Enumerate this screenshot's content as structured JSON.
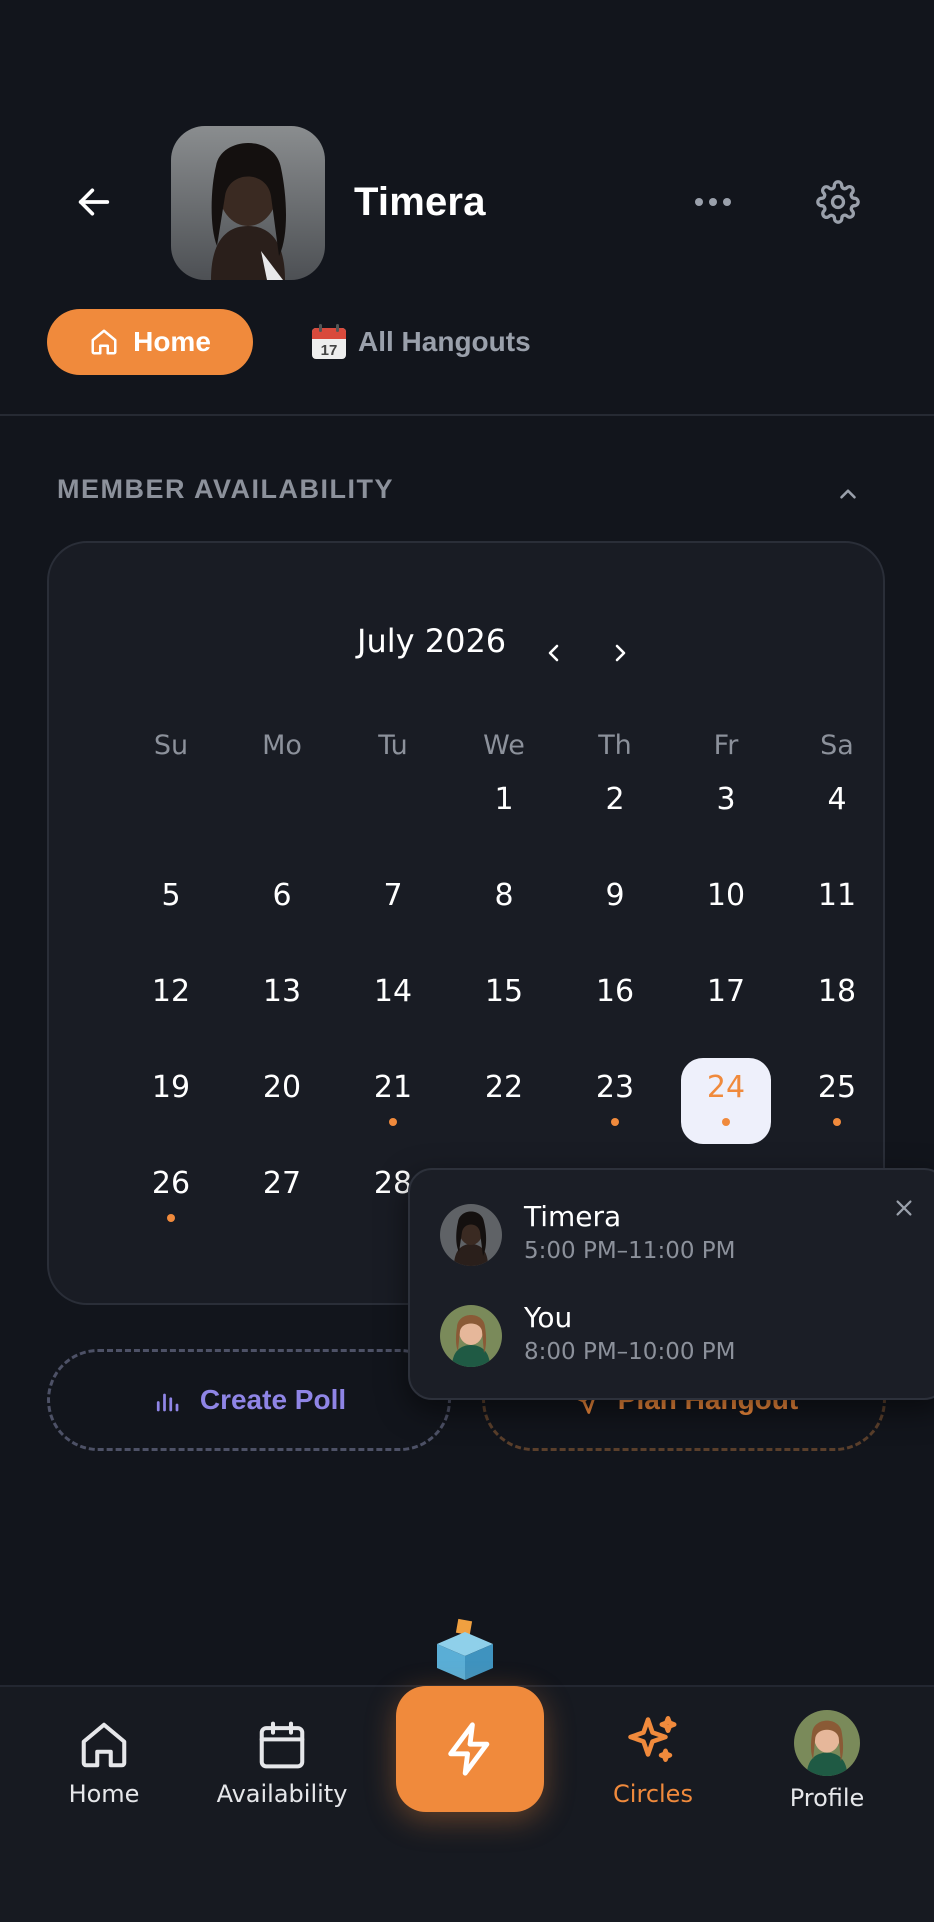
{
  "header": {
    "title": "Timera",
    "back_icon": "arrow-left-icon",
    "more_icon": "more-horizontal-icon",
    "settings_icon": "gear-icon"
  },
  "tabs": [
    {
      "label": "Home",
      "icon": "home-icon",
      "active": true
    },
    {
      "label": "All Hangouts",
      "icon": "calendar-emoji-icon",
      "active": false
    }
  ],
  "calendar_emoji_day": "17",
  "section": {
    "title": "MEMBER AVAILABILITY",
    "collapse_icon": "chevron-up-icon"
  },
  "calendar": {
    "month": "July 2026",
    "weekdays": [
      "Su",
      "Mo",
      "Tu",
      "We",
      "Th",
      "Fr",
      "Sa"
    ],
    "selected_day": "24",
    "days_with_availability": [
      "21",
      "23",
      "24",
      "25",
      "26"
    ]
  },
  "actions": {
    "create_poll": "Create Poll",
    "plan_hangout": "Plan Hangout"
  },
  "popover": {
    "entries": [
      {
        "name": "Timera",
        "time": "5:00 PM–11:00 PM"
      },
      {
        "name": "You",
        "time": "8:00 PM–10:00 PM"
      }
    ],
    "close_icon": "close-icon"
  },
  "nav": {
    "items": [
      {
        "label": "Home",
        "icon": "home-icon"
      },
      {
        "label": "Availability",
        "icon": "calendar-icon"
      },
      {
        "label": "",
        "icon": "lightning-icon"
      },
      {
        "label": "Circles",
        "icon": "sparkles-icon",
        "active": true
      },
      {
        "label": "Profile",
        "icon": "avatar"
      }
    ]
  },
  "colors": {
    "accent": "#f08a3c",
    "background": "#12151c",
    "card": "#191c24",
    "poll": "#8f85e6",
    "muted": "#8c919b"
  }
}
